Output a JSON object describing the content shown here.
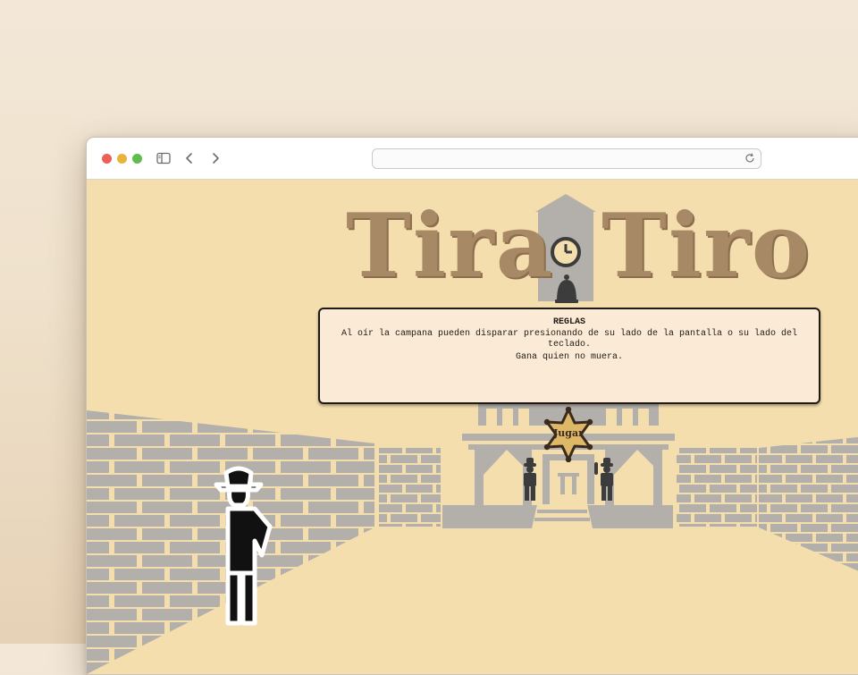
{
  "browser": {
    "url": "",
    "icons": [
      "sidebar-icon",
      "back-icon",
      "forward-icon",
      "reload-icon"
    ]
  },
  "game": {
    "title_left": "Tira",
    "title_right": "Tiro",
    "rules": {
      "heading": "REGLAS",
      "text": "Al oír la campana pueden disparar presionando de su lado de la pantalla o su lado del teclado.",
      "text2": "Gana quien no muera."
    },
    "play_label": "Jugar",
    "colors": {
      "background": "#f5deae",
      "title": "#a88965",
      "bricks": "#b3afaa",
      "star": "#dfb867"
    }
  }
}
